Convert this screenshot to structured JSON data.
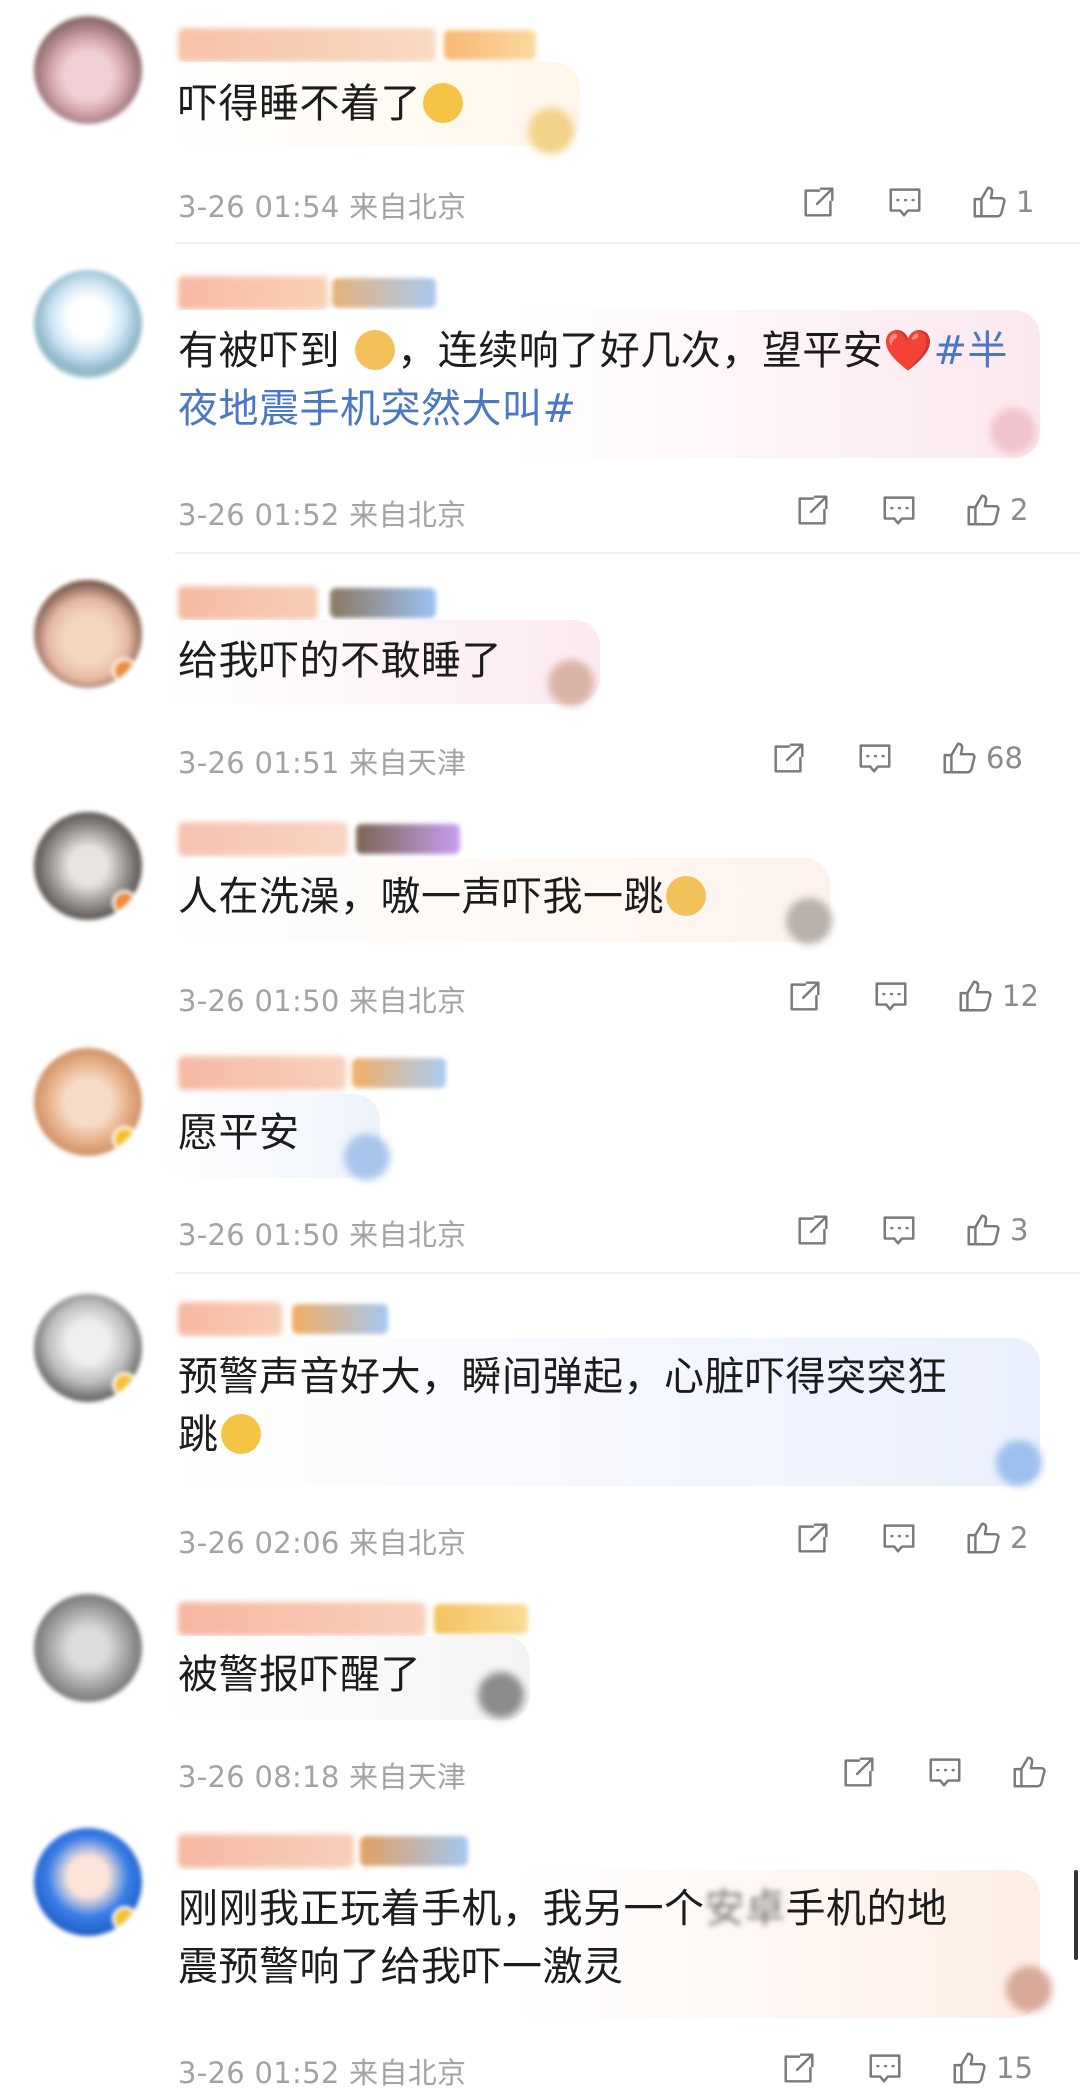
{
  "comments": [
    {
      "text": "吓得睡不着了",
      "emoji": "😭",
      "time": "3-26 01:54",
      "location": "来自北京",
      "likes": "1"
    },
    {
      "text": "有被吓到 ",
      "emoji": "🙇",
      "text2": "，连续响了好几次，望平安",
      "heart": "❤️",
      "tag": "#半夜地震手机突然大叫#",
      "time": "3-26 01:52",
      "location": "来自北京",
      "likes": "2"
    },
    {
      "text": "给我吓的不敢睡了",
      "time": "3-26 01:51",
      "location": "来自天津",
      "likes": "68"
    },
    {
      "text": "人在洗澡，嗷一声吓我一跳",
      "emoji": "🧎",
      "time": "3-26 01:50",
      "location": "来自北京",
      "likes": "12"
    },
    {
      "text": "愿平安",
      "time": "3-26 01:50",
      "location": "来自北京",
      "likes": "3"
    },
    {
      "text": "预警声音好大，瞬间弹起，心脏吓得突突狂",
      "text2": "跳",
      "emoji": "😂",
      "time": "3-26 02:06",
      "location": "来自北京",
      "likes": "2"
    },
    {
      "text": "被警报吓醒了",
      "time": "3-26 08:18",
      "location": "来自天津",
      "likes": ""
    },
    {
      "text": "刚刚我正玩着手机，我另一个",
      "text_blur": "安卓",
      "text_after": "手机的地",
      "text2": "震预警响了给我吓一激灵",
      "time": "3-26 01:52",
      "location": "来自北京",
      "likes": "15"
    }
  ],
  "icons": {
    "share": "share-icon",
    "comment": "comment-icon",
    "like": "like-icon"
  },
  "colors": {
    "tag": "#4a78c2",
    "meta": "#a3a3a3",
    "icon": "#7a7a7a"
  }
}
